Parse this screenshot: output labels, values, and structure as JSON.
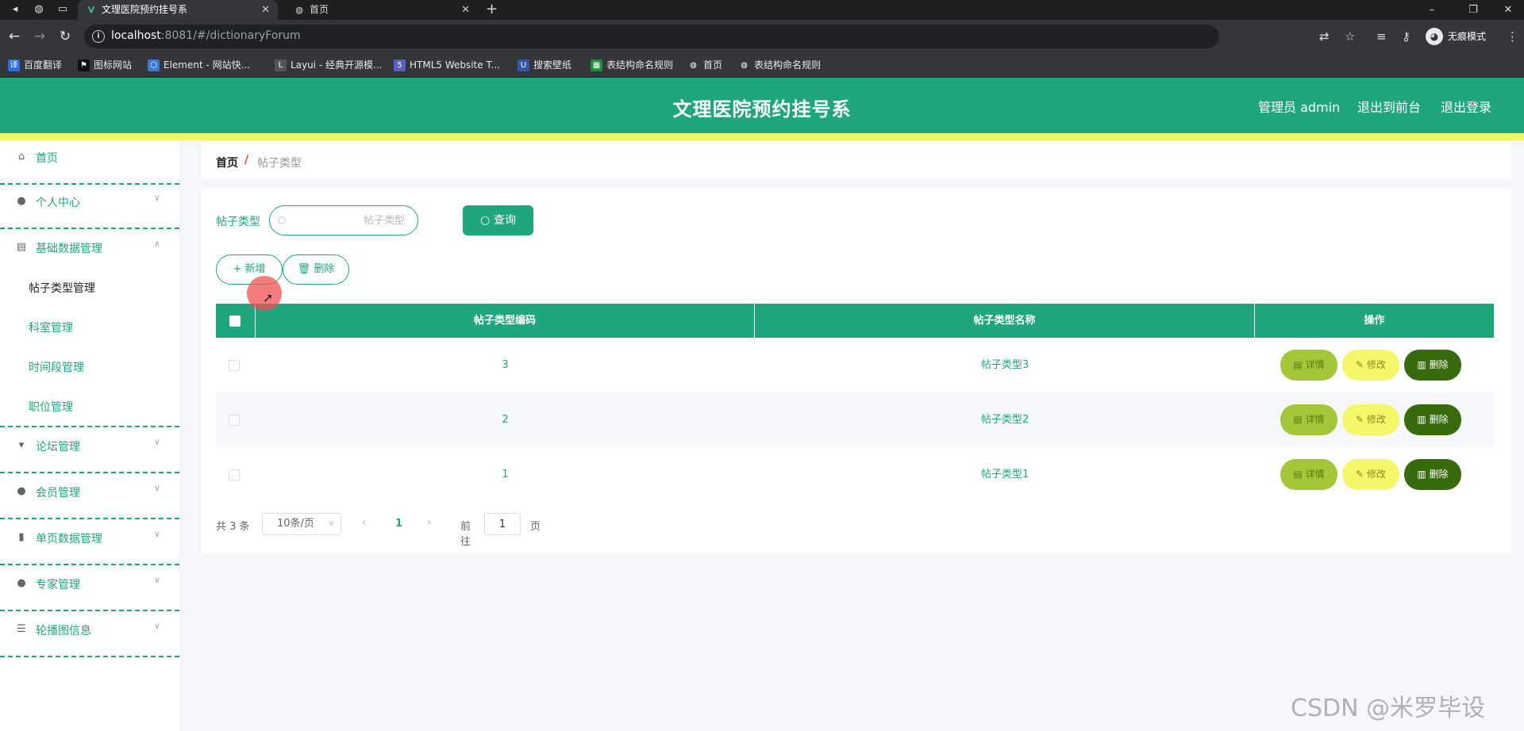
{
  "browser": {
    "tabs": [
      {
        "label": "文理医院预约挂号系",
        "active": true
      },
      {
        "label": "首页",
        "active": false
      }
    ],
    "url_host": "localhost",
    "url_rest": ":8081/#/dictionaryForum",
    "profile_label": "无痕模式",
    "bookmarks": [
      "百度翻译",
      "图标网站",
      "Element - 网站快...",
      "Layui - 经典开源模...",
      "HTML5 Website T...",
      "搜索壁纸",
      "表结构命名规则",
      "首页",
      "表结构命名规则"
    ]
  },
  "header": {
    "title": "文理医院预约挂号系",
    "user": "管理员 admin",
    "to_front": "退出到前台",
    "logout": "退出登录",
    "accent": "#1fa67f",
    "stripe": "#f2f56a"
  },
  "sidebar": {
    "items": [
      {
        "label": "首页",
        "icon": "home-icon"
      },
      {
        "label": "个人中心",
        "icon": "user-icon"
      },
      {
        "label": "基础数据管理",
        "icon": "clipboard-icon",
        "expanded": true
      },
      {
        "label": "论坛管理",
        "icon": "forum-icon"
      },
      {
        "label": "会员管理",
        "icon": "member-icon"
      },
      {
        "label": "单页数据管理",
        "icon": "bar-chart-icon"
      },
      {
        "label": "专家管理",
        "icon": "expert-icon"
      },
      {
        "label": "轮播图信息",
        "icon": "list-icon"
      }
    ],
    "submenu": [
      "帖子类型管理",
      "科室管理",
      "时间段管理",
      "职位管理"
    ]
  },
  "breadcrumb": {
    "home": "首页",
    "separator": "/",
    "current": "帖子类型"
  },
  "search": {
    "label": "帖子类型",
    "placeholder": "帖子类型",
    "button": "查询"
  },
  "actions": {
    "add": "+ 新增",
    "delete": "删除"
  },
  "table": {
    "columns": [
      "帖子类型编码",
      "帖子类型名称",
      "操作"
    ],
    "rows": [
      {
        "code": "3",
        "name": "帖子类型3"
      },
      {
        "code": "2",
        "name": "帖子类型2"
      },
      {
        "code": "1",
        "name": "帖子类型1"
      }
    ],
    "row_actions": {
      "detail": "详情",
      "edit": "修改",
      "delete": "删除"
    }
  },
  "pagination": {
    "total": "共 3 条",
    "page_size": "10条/页",
    "current_page": "1",
    "goto_label": "前往",
    "goto_value": "1",
    "page_suffix": "页"
  },
  "watermark": "CSDN @米罗毕设"
}
